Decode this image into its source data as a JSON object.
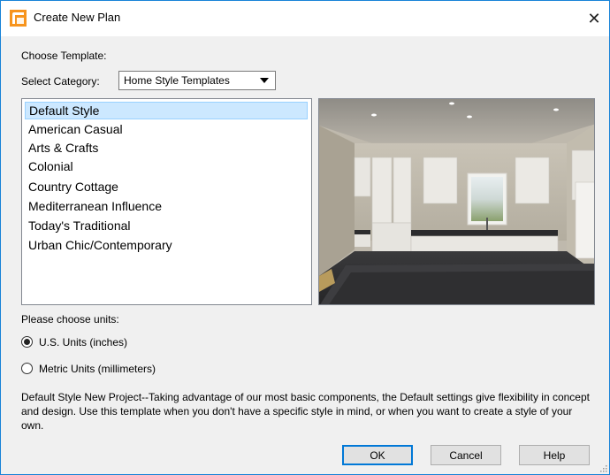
{
  "window": {
    "title": "Create New Plan",
    "close_glyph": "✕",
    "icon": "app-icon"
  },
  "template_section": {
    "heading": "Choose Template:",
    "category_label": "Select Category:",
    "category_value": "Home Style Templates"
  },
  "templates": [
    {
      "label": "Default Style",
      "selected": true
    },
    {
      "label": "American Casual",
      "selected": false
    },
    {
      "label": "Arts & Crafts",
      "selected": false
    },
    {
      "label": "Colonial",
      "selected": false
    },
    {
      "label": "Country Cottage",
      "selected": false
    },
    {
      "label": "Mediterranean Influence",
      "selected": false
    },
    {
      "label": "Today's Traditional",
      "selected": false
    },
    {
      "label": "Urban Chic/Contemporary",
      "selected": false
    }
  ],
  "units": {
    "heading": "Please choose units:",
    "options": [
      {
        "label": "U.S. Units (inches)",
        "checked": true
      },
      {
        "label": "Metric Units (millimeters)",
        "checked": false
      }
    ]
  },
  "description": "Default Style New Project--Taking advantage of our most basic components, the Default settings give flexibility in concept and design. Use this template when you don't have a specific style in mind, or when you want to create a style of your own.",
  "buttons": {
    "ok": "OK",
    "cancel": "Cancel",
    "help": "Help"
  },
  "colors": {
    "accent": "#0078d7",
    "selection": "#cce8ff",
    "dialog_bg": "#f0f0f0"
  }
}
